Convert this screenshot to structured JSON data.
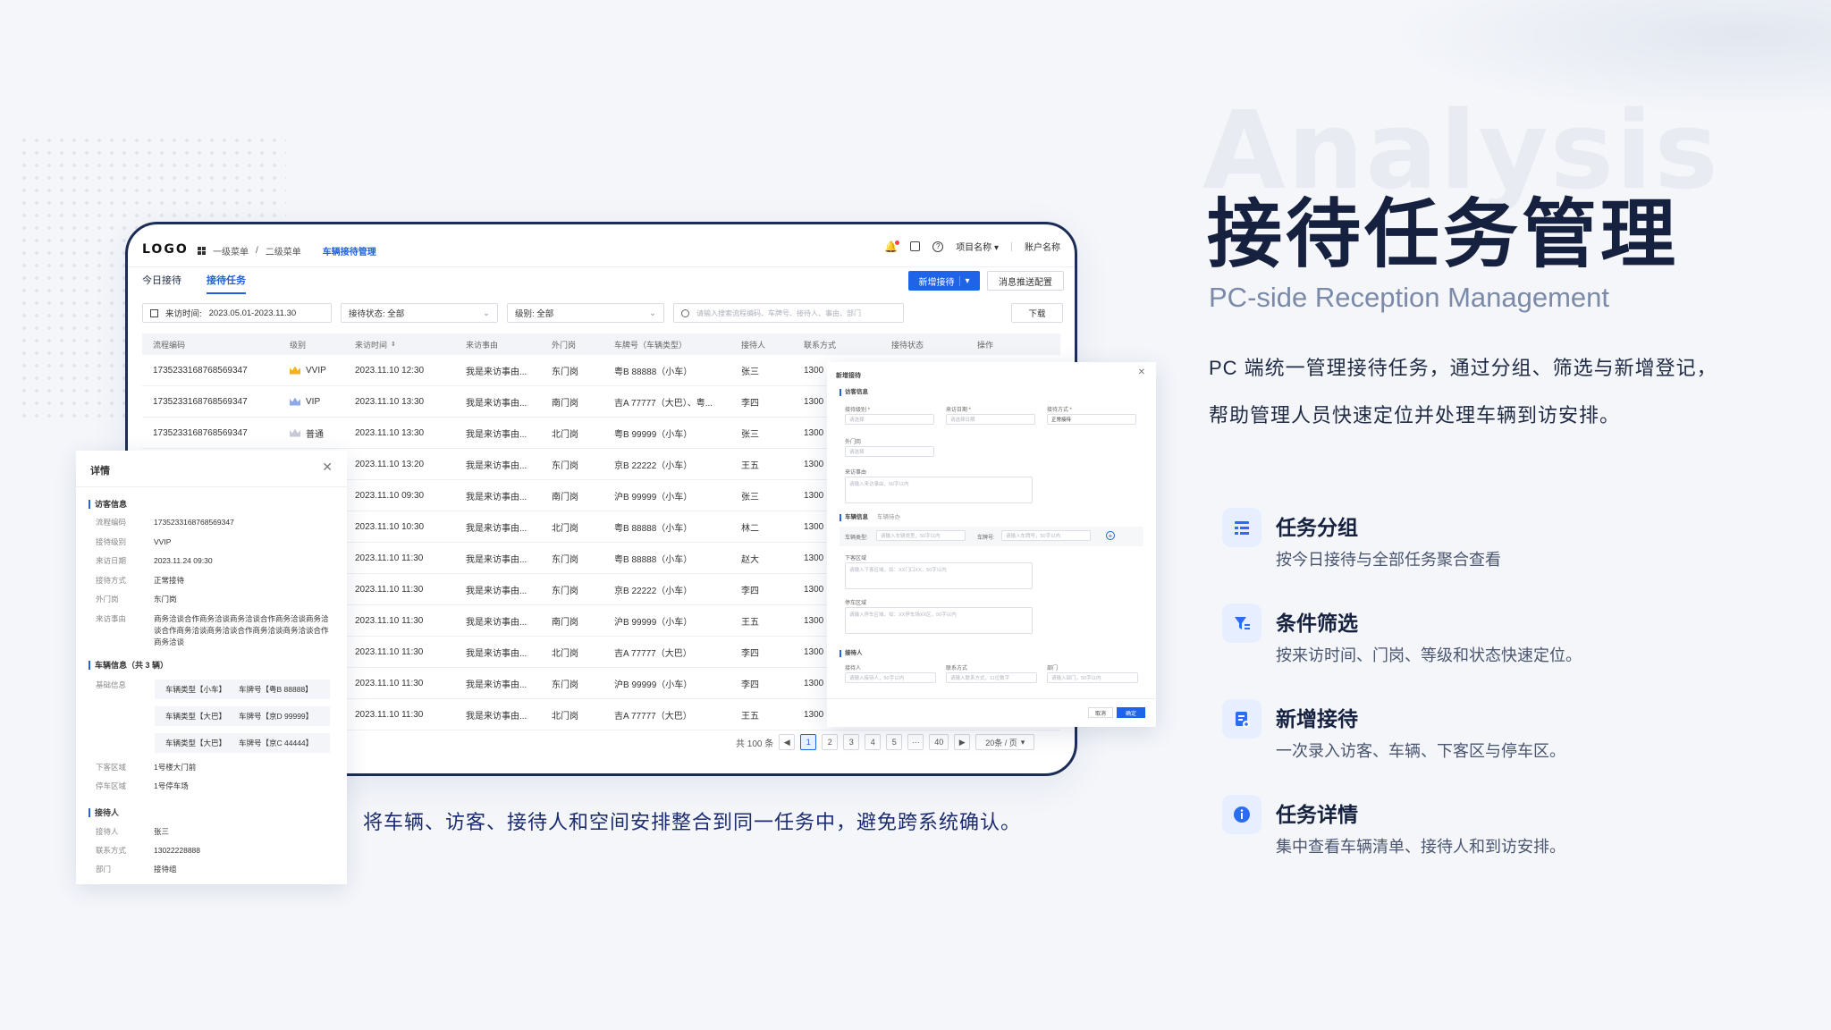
{
  "headline": {
    "title": "接待任务管理",
    "subtitle": "PC-side Reception Management",
    "desc_line1": "PC 端统一管理接待任务，通过分组、筛选与新增登记，",
    "desc_line2": "帮助管理人员快速定位并处理车辆到访安排。",
    "watermark": "Analysis"
  },
  "features": [
    {
      "title": "任务分组",
      "desc": "按今日接待与全部任务聚合查看",
      "icon": "list-icon"
    },
    {
      "title": "条件筛选",
      "desc": "按来访时间、门岗、等级和状态快速定位。",
      "icon": "filter-icon"
    },
    {
      "title": "新增接待",
      "desc": "一次录入访客、车辆、下客区与停车区。",
      "icon": "add-doc-icon"
    },
    {
      "title": "任务详情",
      "desc": "集中查看车辆清单、接待人和到访安排。",
      "icon": "info-icon"
    }
  ],
  "caption": "将车辆、访客、接待人和空间安排整合到同一任务中，避免跨系统确认。",
  "app": {
    "logo": "LOGO",
    "crumbs": [
      "一级菜单",
      "/",
      "二级菜单",
      "车辆接待管理"
    ],
    "project": "项目名称",
    "account": "账户名称",
    "tabs": [
      "今日接待",
      "接待任务"
    ],
    "add_btn": "新增接待",
    "push_btn": "消息推送配置",
    "filters": {
      "time_label": "来访时间:",
      "time_value": "2023.05.01-2023.11.30",
      "status": "接待状态: 全部",
      "level": "级别: 全部",
      "search_ph": "请输入搜索流程编码、车牌号、接待人、事由、部门",
      "download": "下载"
    },
    "columns": [
      "流程编码",
      "级别",
      "来访时间",
      "来访事由",
      "外门岗",
      "车牌号（车辆类型）",
      "接待人",
      "联系方式",
      "接待状态",
      "操作"
    ],
    "rows": [
      {
        "code": "1735233168768569347",
        "level": "VVIP",
        "lvl": "gold",
        "time": "2023.11.10 12:30",
        "reason": "我是来访事由...",
        "gate": "东门岗",
        "plate": "粤B 88888（小车）",
        "host": "张三",
        "phone": "1300"
      },
      {
        "code": "1735233168768569347",
        "level": "VIP",
        "lvl": "blue",
        "time": "2023.11.10 13:30",
        "reason": "我是来访事由...",
        "gate": "南门岗",
        "plate": "吉A 77777（大巴）、粤...",
        "host": "李四",
        "phone": "1300"
      },
      {
        "code": "1735233168768569347",
        "level": "普通",
        "lvl": "gray",
        "time": "2023.11.10 13:30",
        "reason": "我是来访事由...",
        "gate": "北门岗",
        "plate": "粤B 99999（小车）",
        "host": "张三",
        "phone": "1300"
      },
      {
        "code": "",
        "level": "",
        "lvl": "",
        "time": "2023.11.10 13:20",
        "reason": "我是来访事由...",
        "gate": "东门岗",
        "plate": "京B 22222（小车）",
        "host": "王五",
        "phone": "1300"
      },
      {
        "code": "",
        "level": "",
        "lvl": "",
        "time": "2023.11.10 09:30",
        "reason": "我是来访事由...",
        "gate": "南门岗",
        "plate": "沪B 99999（小车）",
        "host": "张三",
        "phone": "1300"
      },
      {
        "code": "",
        "level": "",
        "lvl": "",
        "time": "2023.11.10 10:30",
        "reason": "我是来访事由...",
        "gate": "北门岗",
        "plate": "粤B 88888（小车）",
        "host": "林二",
        "phone": "1300"
      },
      {
        "code": "",
        "level": "",
        "lvl": "",
        "time": "2023.11.10 11:30",
        "reason": "我是来访事由...",
        "gate": "东门岗",
        "plate": "粤B 88888（小车）",
        "host": "赵大",
        "phone": "1300"
      },
      {
        "code": "",
        "level": "",
        "lvl": "",
        "time": "2023.11.10 11:30",
        "reason": "我是来访事由...",
        "gate": "东门岗",
        "plate": "京B 22222（小车）",
        "host": "李四",
        "phone": "1300"
      },
      {
        "code": "",
        "level": "",
        "lvl": "",
        "time": "2023.11.10 11:30",
        "reason": "我是来访事由...",
        "gate": "南门岗",
        "plate": "沪B 99999（小车）",
        "host": "王五",
        "phone": "1300"
      },
      {
        "code": "",
        "level": "",
        "lvl": "",
        "time": "2023.11.10 11:30",
        "reason": "我是来访事由...",
        "gate": "北门岗",
        "plate": "吉A 77777（大巴）",
        "host": "李四",
        "phone": "1300"
      },
      {
        "code": "",
        "level": "",
        "lvl": "",
        "time": "2023.11.10 11:30",
        "reason": "我是来访事由...",
        "gate": "东门岗",
        "plate": "沪B 99999（小车）",
        "host": "李四",
        "phone": "1300"
      },
      {
        "code": "",
        "level": "",
        "lvl": "",
        "time": "2023.11.10 11:30",
        "reason": "我是来访事由...",
        "gate": "北门岗",
        "plate": "吉A 77777（大巴）",
        "host": "王五",
        "phone": "1300"
      }
    ],
    "pager": {
      "total": "共 100 条",
      "pages": [
        "1",
        "2",
        "3",
        "4",
        "5",
        "···",
        "40"
      ],
      "size": "20条 / 页"
    }
  },
  "detail": {
    "title": "详情",
    "sec_visitor": "访客信息",
    "visitor": [
      [
        "流程编码",
        "1735233168768569347"
      ],
      [
        "接待级别",
        "VVIP"
      ],
      [
        "来访日期",
        "2023.11.24 09:30"
      ],
      [
        "接待方式",
        "正常接待"
      ],
      [
        "外门岗",
        "东门岗"
      ],
      [
        "来访事由",
        "商务洽谈合作商务洽谈商务洽谈合作商务洽谈商务洽谈合作商务洽谈商务洽谈合作商务洽谈商务洽谈合作商务洽谈"
      ]
    ],
    "sec_vehicle": "车辆信息（共 3 辆）",
    "base_label": "基础信息",
    "vehicles": [
      [
        "车辆类型【小车】",
        "车牌号【粤B 88888】"
      ],
      [
        "车辆类型【大巴】",
        "车牌号【京D 99999】"
      ],
      [
        "车辆类型【大巴】",
        "车牌号【京C 44444】"
      ]
    ],
    "area": [
      [
        "下客区域",
        "1号楼大门前"
      ],
      [
        "停车区域",
        "1号停车场"
      ]
    ],
    "sec_host": "接待人",
    "host": [
      [
        "接待人",
        "张三"
      ],
      [
        "联系方式",
        "13022228888"
      ],
      [
        "部门",
        "接待组"
      ]
    ]
  },
  "newform": {
    "title": "新增接待",
    "sec1": "访客信息",
    "l1": "接待级别 *",
    "l2": "来访日期 *",
    "l3": "接待方式 *",
    "l4": "外门岗",
    "l5": "来访事由",
    "p1": "请选择",
    "p2": "请选择日期",
    "v3": "正常接待",
    "p4": "请选择",
    "p5": "请输入来访事由，50字以内",
    "sec2": "车辆信息",
    "sec2b": "车辆待办",
    "l6": "车辆类型:",
    "p6": "请输入车辆类型，50字以内",
    "l7": "车牌号:",
    "p7": "请输入车牌号，50字以内",
    "l8": "下客区域",
    "p8": "请输入下客区域，如：XX门口XX，50字以内",
    "l9": "停车区域",
    "p9": "请输入停车区域，如：XX停车场XX区，50字以内",
    "sec3": "接待人",
    "l10": "接待人",
    "p10": "请输入接待人，50字以内",
    "l11": "联系方式",
    "p11": "请输入联系方式，11位数字",
    "l12": "部门",
    "p12": "请输入部门，50字以内",
    "cancel": "取消",
    "ok": "确定"
  },
  "colors": {
    "primary": "#1f63e8",
    "navy": "#15213f",
    "gold": "#f2b21c",
    "vip_blue": "#8fa8e6",
    "normal_gray": "#c5cad6"
  }
}
